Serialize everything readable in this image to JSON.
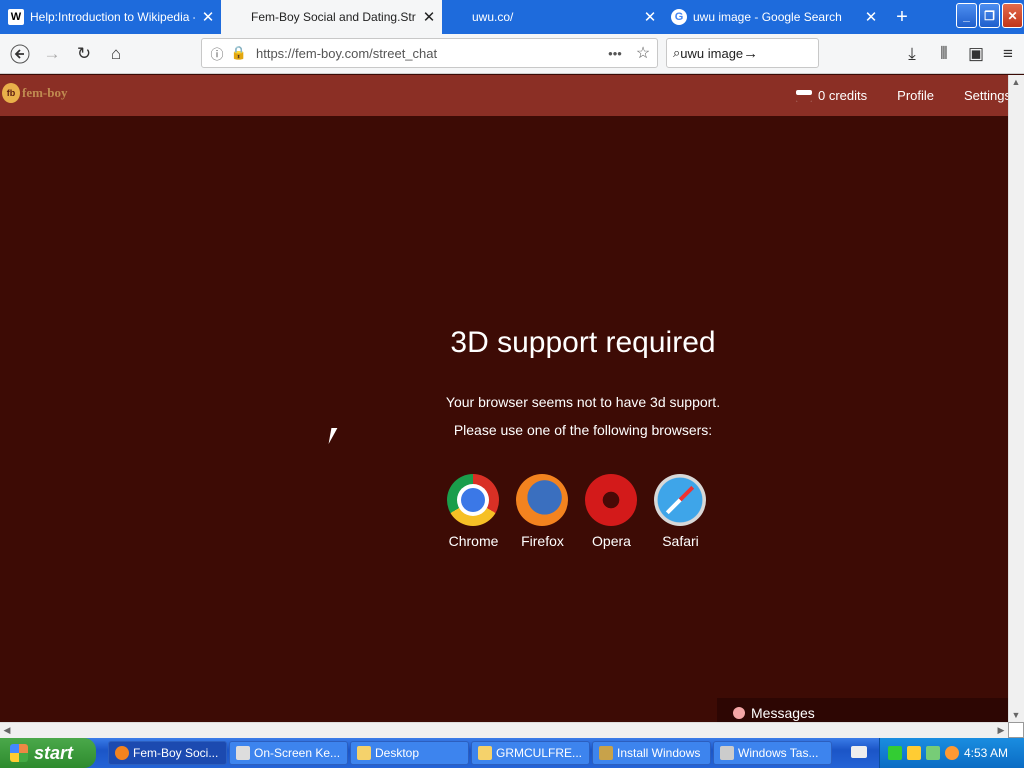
{
  "browser": {
    "tabs": [
      {
        "title": "Help:Introduction to Wikipedia - W",
        "icon": "wikipedia-icon",
        "active": false
      },
      {
        "title": "Fem-Boy Social and Dating.Street",
        "icon": "none",
        "active": true
      },
      {
        "title": "uwu.co/",
        "icon": "none",
        "active": false
      },
      {
        "title": "uwu image - Google Search",
        "icon": "google-icon",
        "active": false
      }
    ],
    "new_tab": "+",
    "url": "https://fem-boy.com/street_chat",
    "search_value": "uwu image"
  },
  "site": {
    "credits": "0 credits",
    "nav": [
      "Profile",
      "Settings"
    ]
  },
  "notice": {
    "title": "3D support required",
    "line1": "Your browser seems not to have 3d support.",
    "line2": "Please use one of the following browsers:",
    "browsers": [
      "Chrome",
      "Firefox",
      "Opera",
      "Safari"
    ]
  },
  "messages": "Messages",
  "taskbar": {
    "start": "start",
    "items": [
      {
        "label": "Fem-Boy Soci...",
        "icon": "firefox-icon"
      },
      {
        "label": "On-Screen Ke...",
        "icon": "keyboard-icon"
      },
      {
        "label": "Desktop",
        "icon": "folder-icon"
      },
      {
        "label": "GRMCULFRE...",
        "icon": "folder-icon"
      },
      {
        "label": "Install Windows",
        "icon": "setup-icon"
      },
      {
        "label": "Windows Tas...",
        "icon": "monitor-icon"
      }
    ],
    "clock": "4:53 AM"
  },
  "colors": {
    "page_bg": "#3d0b05",
    "header_bg": "#8b2f25",
    "tabbar": "#1e6bdc"
  }
}
